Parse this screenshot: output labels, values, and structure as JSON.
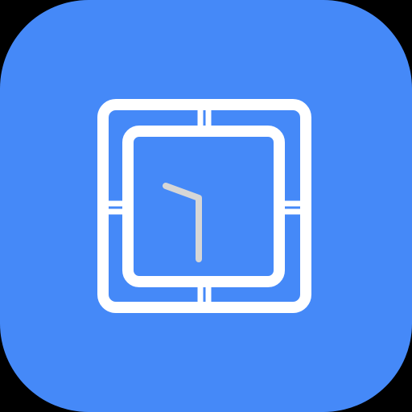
{
  "app_icon": {
    "icon_name": "square-clock-icon",
    "colors": {
      "tile_background": "#4589f8",
      "outer_background": "#000000",
      "frame_stroke": "#ffffff",
      "hand_stroke": "#d6d6d6"
    }
  }
}
